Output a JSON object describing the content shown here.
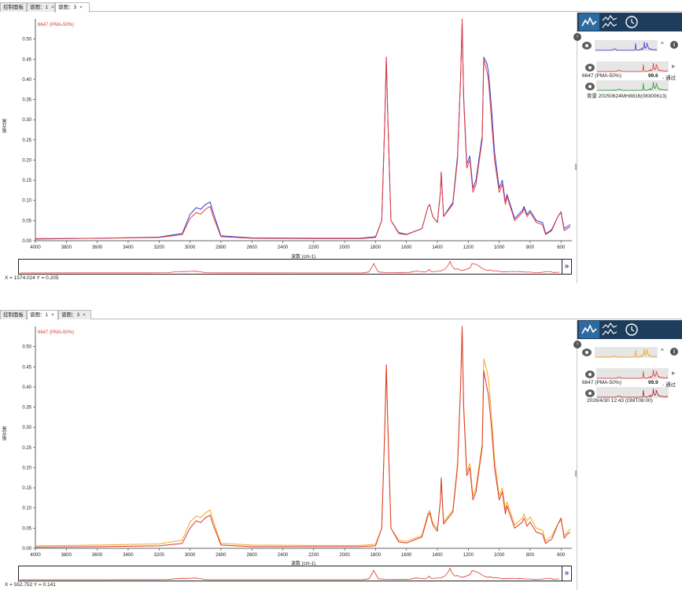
{
  "panes": [
    {
      "tabs": [
        {
          "label": "控制面板",
          "close": ""
        },
        {
          "label": "谱图：1",
          "close": "×"
        },
        {
          "label": "谱图：3",
          "close": "×"
        }
      ],
      "active_tab": 2,
      "legend_label": "6647 (PMA-50%)",
      "ylabel": "吸光度",
      "xlabel": "波数 (cm-1)",
      "coord_readout": "X = 1574.024 Y = 0.205",
      "colors": {
        "sample": "#e83b3b",
        "reference": "#2f3fd6"
      },
      "side": {
        "result_name": "6647 (PMA-50%)",
        "result_score": "99.6",
        "result_status": "- 通过",
        "secondary_label": "背景 20250624MH8816(08300613)",
        "colors": {
          "thumb_main": "#3a3ad6",
          "thumb_result": "#e03c3c",
          "thumb_secondary": "#2e9a2e"
        }
      }
    },
    {
      "tabs": [
        {
          "label": "控制面板",
          "close": ""
        },
        {
          "label": "谱图：1",
          "close": "×"
        },
        {
          "label": "谱图：3",
          "close": "×"
        }
      ],
      "active_tab": 1,
      "legend_label": "6647 (PMA-50%)",
      "ylabel": "吸光度",
      "xlabel": "波数 (cm-1)",
      "coord_readout": "X = 552.752 Y = 0.141",
      "colors": {
        "sample": "#d83a2a",
        "reference": "#f5a623"
      },
      "side": {
        "result_name": "6647 (PMA-50%)",
        "result_score": "99.9",
        "result_status": "- 通过",
        "secondary_label": "2026/4/30 12:43 (GMT08:00)",
        "colors": {
          "thumb_main": "#f5a623",
          "thumb_result": "#e03c3c",
          "thumb_secondary": "#b22222"
        }
      }
    }
  ],
  "chart_data": [
    {
      "type": "line",
      "xlabel": "波数 (cm-1)",
      "ylabel": "吸光度",
      "xlim": [
        4000,
        530
      ],
      "ylim": [
        0,
        0.55
      ],
      "x_ticks": [
        4000,
        3800,
        3600,
        3400,
        3200,
        3000,
        2800,
        2600,
        2400,
        2200,
        2000,
        1800,
        1600,
        1400,
        1200,
        1000,
        800,
        600
      ],
      "y_ticks": [
        0.0,
        0.05,
        0.1,
        0.15,
        0.2,
        0.25,
        0.3,
        0.35,
        0.4,
        0.45,
        0.5
      ],
      "y_tick_labels": [
        "0.00",
        "0.05",
        "0.10",
        "0.15",
        "0.20",
        "0.25",
        "0.30",
        "0.35",
        "0.40",
        "0.45",
        "0.50"
      ],
      "grid": false,
      "series": [
        {
          "name": "6647 (PMA-50%)",
          "color": "#e83b3b",
          "x": [
            4000,
            3600,
            3200,
            3050,
            3000,
            2960,
            2930,
            2900,
            2870,
            2850,
            2800,
            2600,
            2200,
            1900,
            1800,
            1760,
            1740,
            1730,
            1720,
            1700,
            1650,
            1600,
            1500,
            1460,
            1450,
            1430,
            1400,
            1380,
            1375,
            1360,
            1300,
            1270,
            1250,
            1240,
            1230,
            1210,
            1190,
            1170,
            1150,
            1110,
            1100,
            1080,
            1070,
            1050,
            1030,
            1000,
            980,
            960,
            950,
            900,
            850,
            840,
            820,
            800,
            760,
            720,
            700,
            680,
            660,
            620,
            600,
            580,
            560,
            540
          ],
          "y": [
            0.005,
            0.006,
            0.008,
            0.015,
            0.055,
            0.07,
            0.066,
            0.078,
            0.085,
            0.06,
            0.01,
            0.006,
            0.005,
            0.005,
            0.008,
            0.05,
            0.3,
            0.455,
            0.3,
            0.05,
            0.018,
            0.015,
            0.03,
            0.085,
            0.09,
            0.06,
            0.045,
            0.12,
            0.17,
            0.06,
            0.09,
            0.2,
            0.4,
            0.55,
            0.35,
            0.18,
            0.2,
            0.12,
            0.14,
            0.25,
            0.45,
            0.42,
            0.4,
            0.3,
            0.2,
            0.12,
            0.14,
            0.09,
            0.11,
            0.05,
            0.07,
            0.08,
            0.06,
            0.07,
            0.045,
            0.04,
            0.015,
            0.02,
            0.025,
            0.06,
            0.07,
            0.025,
            0.03,
            0.035
          ]
        },
        {
          "name": "",
          "color": "#2f3fd6",
          "x": [
            4000,
            3600,
            3200,
            3050,
            3000,
            2960,
            2930,
            2900,
            2870,
            2850,
            2800,
            2600,
            2200,
            1900,
            1800,
            1760,
            1740,
            1730,
            1720,
            1700,
            1650,
            1600,
            1500,
            1460,
            1450,
            1430,
            1400,
            1380,
            1375,
            1360,
            1300,
            1270,
            1250,
            1240,
            1230,
            1210,
            1190,
            1170,
            1150,
            1110,
            1100,
            1080,
            1070,
            1050,
            1030,
            1000,
            980,
            960,
            950,
            900,
            850,
            840,
            820,
            800,
            760,
            720,
            700,
            680,
            660,
            620,
            600,
            580,
            560,
            540
          ],
          "y": [
            0.004,
            0.006,
            0.009,
            0.018,
            0.065,
            0.082,
            0.078,
            0.09,
            0.096,
            0.07,
            0.012,
            0.007,
            0.006,
            0.006,
            0.01,
            0.05,
            0.3,
            0.455,
            0.3,
            0.05,
            0.02,
            0.016,
            0.03,
            0.085,
            0.09,
            0.06,
            0.045,
            0.12,
            0.17,
            0.06,
            0.095,
            0.21,
            0.4,
            0.54,
            0.36,
            0.19,
            0.21,
            0.13,
            0.15,
            0.26,
            0.455,
            0.44,
            0.42,
            0.33,
            0.22,
            0.13,
            0.15,
            0.095,
            0.115,
            0.055,
            0.075,
            0.085,
            0.065,
            0.075,
            0.05,
            0.045,
            0.018,
            0.022,
            0.028,
            0.06,
            0.072,
            0.03,
            0.035,
            0.04
          ]
        }
      ]
    },
    {
      "type": "line",
      "xlabel": "波数 (cm-1)",
      "ylabel": "吸光度",
      "xlim": [
        4000,
        530
      ],
      "ylim": [
        0,
        0.55
      ],
      "x_ticks": [
        4000,
        3800,
        3600,
        3400,
        3200,
        3000,
        2800,
        2600,
        2400,
        2200,
        2000,
        1800,
        1600,
        1400,
        1200,
        1000,
        800,
        600
      ],
      "y_ticks": [
        0.0,
        0.05,
        0.1,
        0.15,
        0.2,
        0.25,
        0.3,
        0.35,
        0.4,
        0.45,
        0.5
      ],
      "y_tick_labels": [
        "0.00",
        "0.05",
        "0.10",
        "0.15",
        "0.20",
        "0.25",
        "0.30",
        "0.35",
        "0.40",
        "0.45",
        "0.50"
      ],
      "grid": false,
      "series": [
        {
          "name": "6647 (PMA-50%)",
          "color": "#d83a2a",
          "x": [
            4000,
            3600,
            3200,
            3050,
            3000,
            2960,
            2930,
            2900,
            2870,
            2850,
            2800,
            2600,
            2200,
            1900,
            1800,
            1760,
            1740,
            1730,
            1720,
            1700,
            1650,
            1600,
            1500,
            1460,
            1450,
            1430,
            1400,
            1380,
            1375,
            1360,
            1300,
            1270,
            1250,
            1240,
            1230,
            1210,
            1190,
            1170,
            1150,
            1110,
            1100,
            1080,
            1070,
            1050,
            1030,
            1000,
            980,
            960,
            950,
            900,
            850,
            840,
            820,
            800,
            760,
            720,
            700,
            680,
            660,
            620,
            600,
            580,
            560,
            540
          ],
          "y": [
            0.003,
            0.004,
            0.006,
            0.012,
            0.05,
            0.068,
            0.064,
            0.076,
            0.082,
            0.058,
            0.008,
            0.004,
            0.004,
            0.004,
            0.006,
            0.05,
            0.3,
            0.455,
            0.3,
            0.05,
            0.016,
            0.013,
            0.028,
            0.082,
            0.088,
            0.058,
            0.042,
            0.12,
            0.175,
            0.06,
            0.09,
            0.2,
            0.4,
            0.55,
            0.35,
            0.18,
            0.2,
            0.12,
            0.14,
            0.25,
            0.44,
            0.4,
            0.38,
            0.3,
            0.2,
            0.12,
            0.14,
            0.085,
            0.105,
            0.05,
            0.065,
            0.075,
            0.055,
            0.065,
            0.04,
            0.035,
            0.012,
            0.018,
            0.022,
            0.06,
            0.075,
            0.025,
            0.035,
            0.04
          ]
        },
        {
          "name": "",
          "color": "#f5a623",
          "x": [
            4000,
            3600,
            3200,
            3050,
            3000,
            2960,
            2930,
            2900,
            2870,
            2850,
            2800,
            2600,
            2200,
            1900,
            1800,
            1760,
            1740,
            1730,
            1720,
            1700,
            1650,
            1600,
            1500,
            1460,
            1450,
            1430,
            1400,
            1380,
            1375,
            1360,
            1300,
            1270,
            1250,
            1240,
            1230,
            1210,
            1190,
            1170,
            1150,
            1110,
            1100,
            1080,
            1070,
            1050,
            1030,
            1000,
            980,
            960,
            950,
            900,
            850,
            840,
            820,
            800,
            760,
            720,
            700,
            680,
            660,
            620,
            600,
            580,
            560,
            540
          ],
          "y": [
            0.006,
            0.008,
            0.011,
            0.02,
            0.065,
            0.08,
            0.076,
            0.088,
            0.095,
            0.068,
            0.012,
            0.008,
            0.007,
            0.007,
            0.01,
            0.05,
            0.3,
            0.455,
            0.3,
            0.05,
            0.02,
            0.017,
            0.032,
            0.088,
            0.094,
            0.064,
            0.048,
            0.12,
            0.17,
            0.065,
            0.095,
            0.21,
            0.4,
            0.54,
            0.36,
            0.19,
            0.21,
            0.13,
            0.15,
            0.26,
            0.47,
            0.44,
            0.42,
            0.33,
            0.22,
            0.13,
            0.15,
            0.095,
            0.115,
            0.058,
            0.075,
            0.085,
            0.068,
            0.078,
            0.05,
            0.045,
            0.018,
            0.024,
            0.03,
            0.06,
            0.07,
            0.032,
            0.04,
            0.048
          ]
        }
      ]
    }
  ]
}
